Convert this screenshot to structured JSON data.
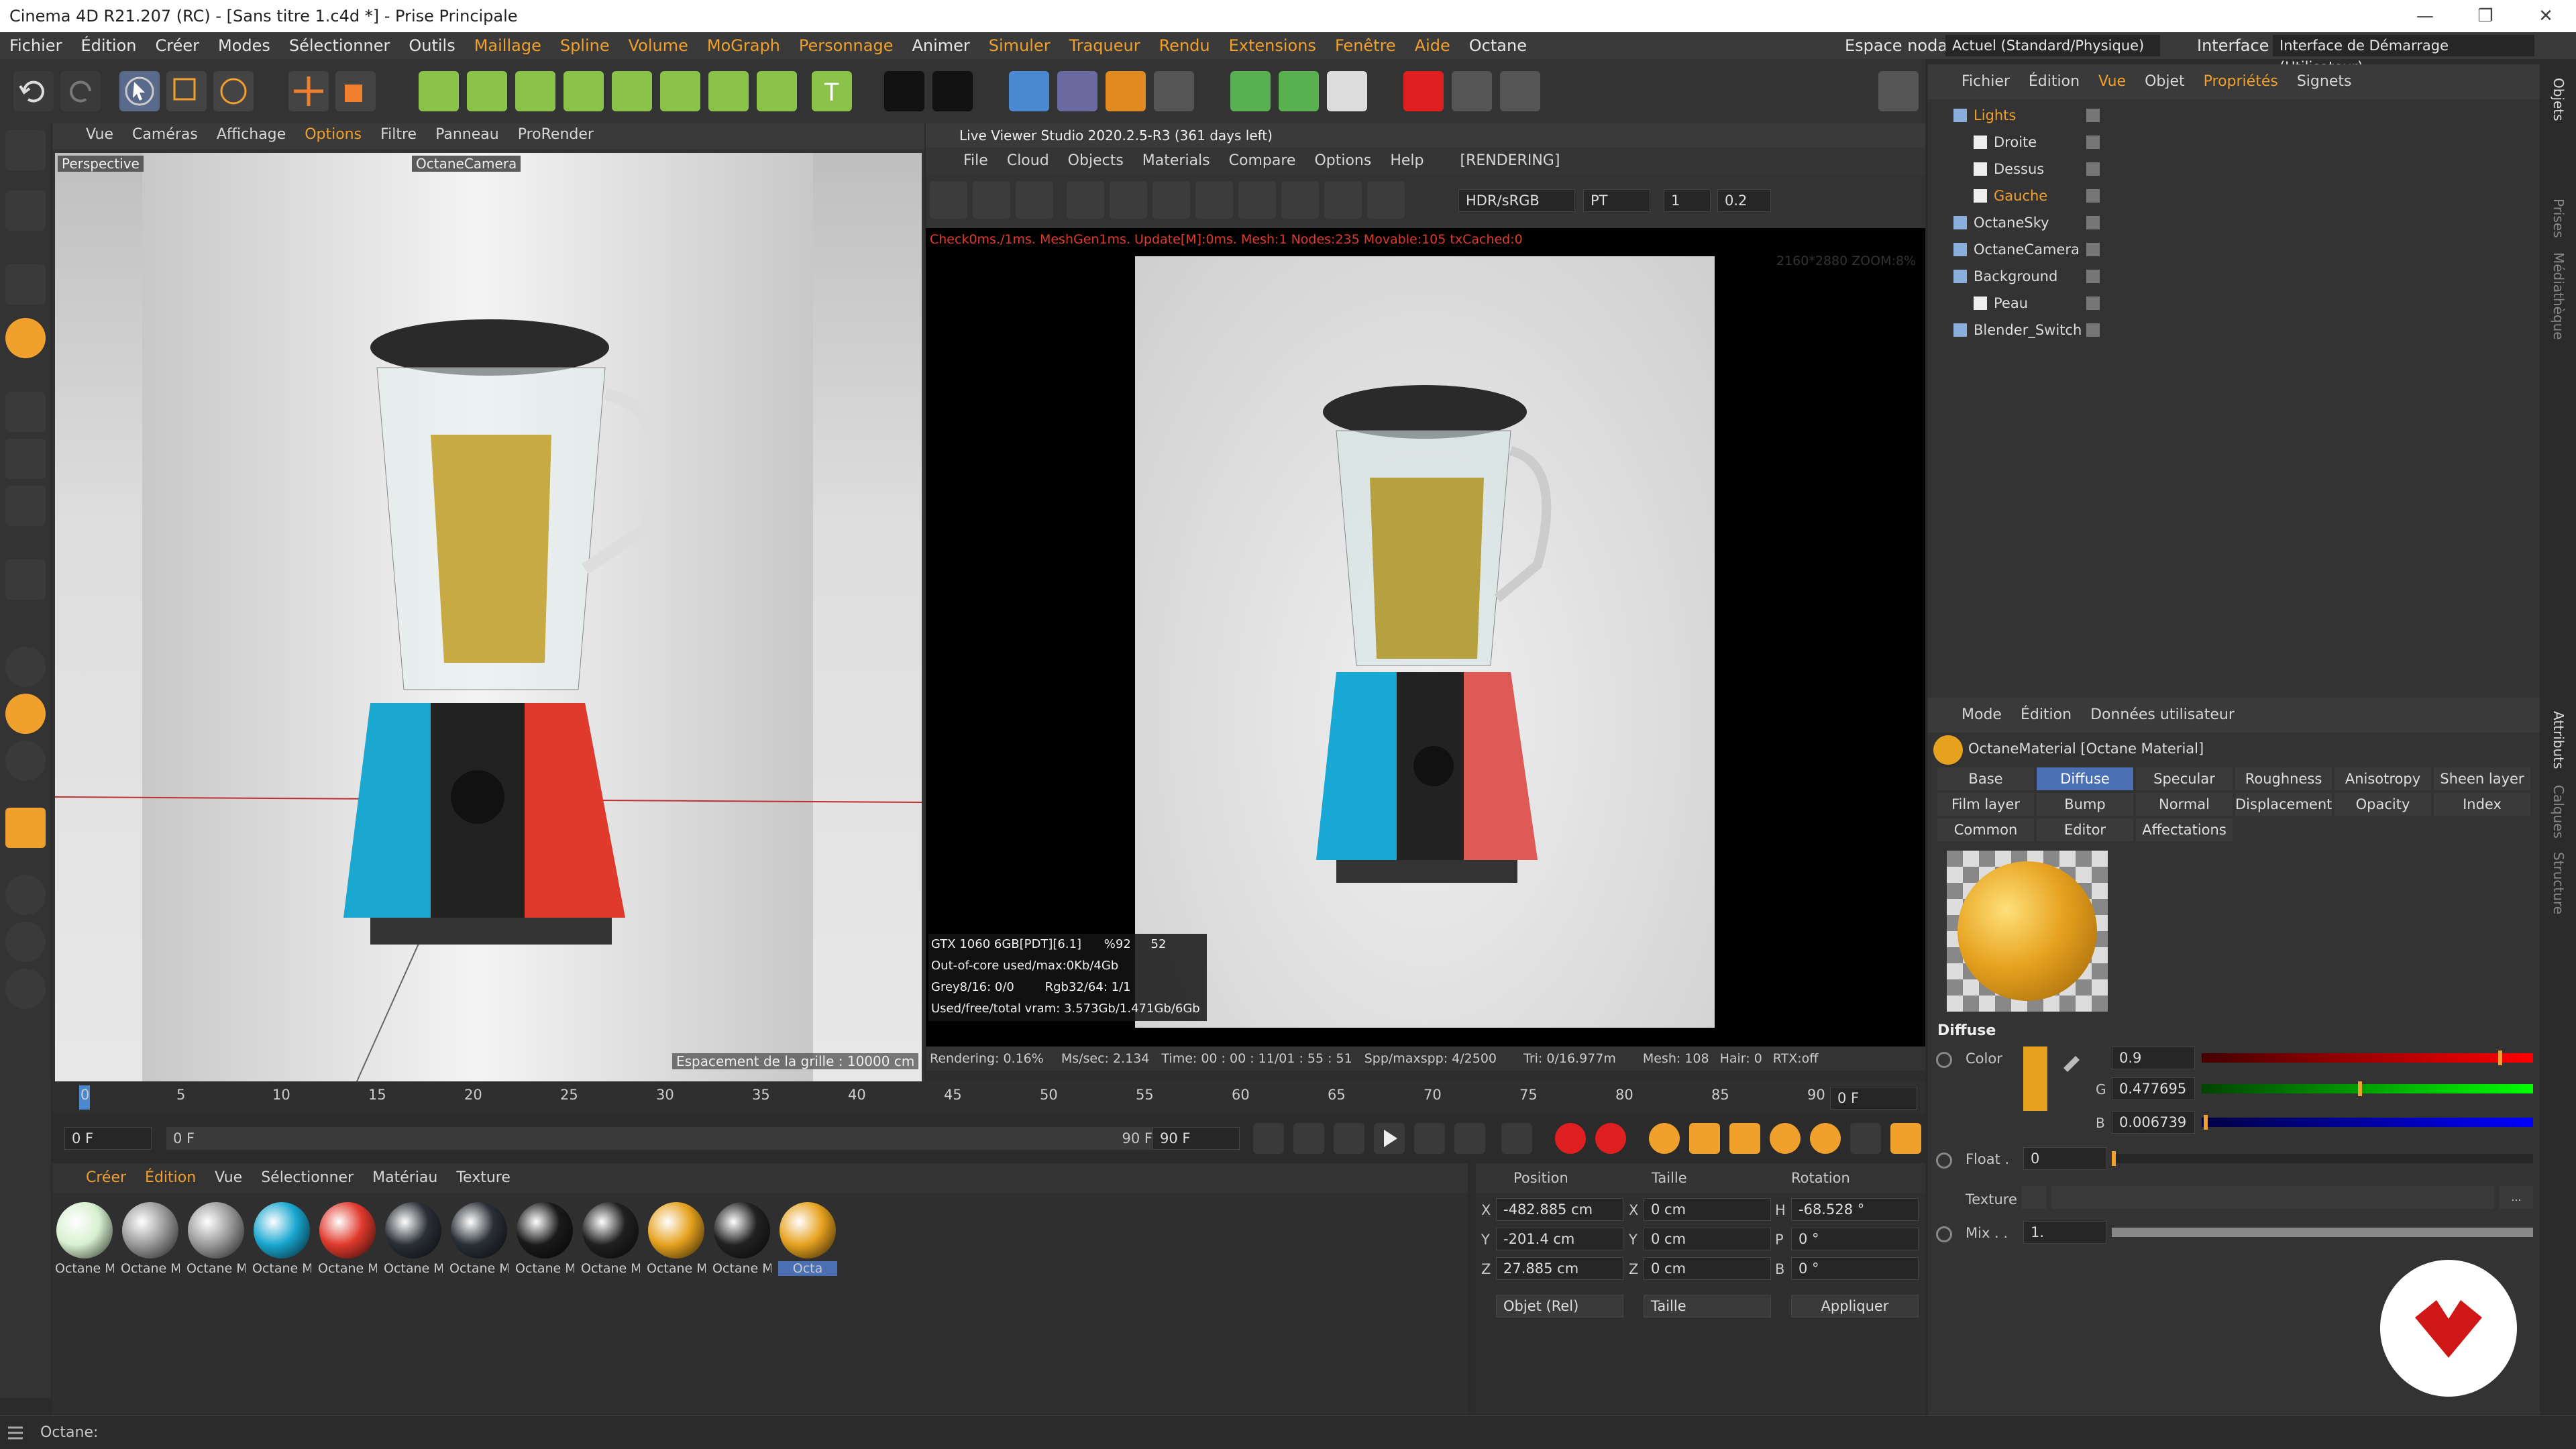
{
  "titlebar": {
    "title": "Cinema 4D R21.207 (RC) - [Sans titre 1.c4d *] - Prise Principale",
    "minimize": "—",
    "maximize": "❐",
    "close": "✕"
  },
  "menubar": {
    "items": [
      "Fichier",
      "Édition",
      "Créer",
      "Modes",
      "Sélectionner",
      "Outils",
      "Maillage",
      "Spline",
      "Volume",
      "MoGraph",
      "Personnage",
      "Animer",
      "Simuler",
      "Traqueur",
      "Rendu",
      "Extensions",
      "Fenêtre",
      "Aide",
      "Octane"
    ],
    "espace_nodal_label": "Espace nodal :",
    "espace_nodal_value": "Actuel (Standard/Physique)",
    "interface_label": "Interface :",
    "interface_value": "Interface de Démarrage (Utilisateur)"
  },
  "viewport": {
    "menu": [
      "Vue",
      "Caméras",
      "Affichage",
      "Options",
      "Filtre",
      "Panneau",
      "ProRender"
    ],
    "label": "Perspective",
    "camera": "OctaneCamera",
    "grid": "Espacement de la grille : 10000 cm"
  },
  "liveviewer": {
    "title": "Live Viewer Studio 2020.2.5-R3 (361 days left)",
    "menu": [
      "File",
      "Cloud",
      "Objects",
      "Materials",
      "Compare",
      "Options",
      "Help"
    ],
    "status": "[RENDERING]",
    "hdr": "HDR/sRGB",
    "mode": "PT",
    "val1": "1",
    "val2": "0.2",
    "check": "Check0ms./1ms. MeshGen1ms. Update[M]:0ms. Mesh:1 Nodes:235 Movable:105 txCached:0",
    "zoom": "2160*2880 ZOOM:8%",
    "gpu": "GTX 1060 6GB[PDT][6.1]",
    "gpu_pct": "%92",
    "gpu_temp": "52",
    "outofcore": "Out-of-core used/max:0Kb/4Gb",
    "grey": "Grey8/16: 0/0",
    "rgb": "Rgb32/64: 1/1",
    "vram": "Used/free/total vram: 3.573Gb/1.471Gb/6Gb",
    "rendering": "Rendering: 0.16%",
    "mssec": "Ms/sec: 2.134",
    "time": "Time: 00 : 00 : 11/01 : 55 : 51",
    "spp": "Spp/maxspp: 4/2500",
    "tri": "Tri: 0/16.977m",
    "mesh": "Mesh: 108",
    "hair": "Hair: 0",
    "rtx": "RTX:off"
  },
  "objects": {
    "menu": [
      "Fichier",
      "Édition",
      "Vue",
      "Objet",
      "Propriétés",
      "Signets"
    ],
    "rows": [
      {
        "name": "Lights",
        "indent": 0,
        "color": "#f0a02d"
      },
      {
        "name": "Droite",
        "indent": 1,
        "color": "#dddddd"
      },
      {
        "name": "Dessus",
        "indent": 1,
        "color": "#dddddd"
      },
      {
        "name": "Gauche",
        "indent": 1,
        "color": "#f0a02d"
      },
      {
        "name": "OctaneSky",
        "indent": 0,
        "color": "#dddddd"
      },
      {
        "name": "OctaneCamera",
        "indent": 0,
        "color": "#dddddd"
      },
      {
        "name": "Background",
        "indent": 0,
        "color": "#dddddd"
      },
      {
        "name": "Peau",
        "indent": 1,
        "color": "#dddddd"
      },
      {
        "name": "Blender_Switch",
        "indent": 0,
        "color": "#dddddd"
      }
    ],
    "side_tabs": [
      "Objets",
      "Prises",
      "Médiathèque"
    ]
  },
  "attributes": {
    "menu": [
      "Mode",
      "Édition",
      "Données utilisateur"
    ],
    "material": "OctaneMaterial [Octane Material]",
    "tabs_row1": [
      "Base",
      "Diffuse",
      "Specular",
      "Roughness",
      "Anisotropy",
      "Sheen layer"
    ],
    "tabs_row2": [
      "Film layer",
      "Bump",
      "Normal",
      "Displacement",
      "Opacity",
      "Index"
    ],
    "tabs_row3": [
      "Common",
      "Editor",
      "Affectations"
    ],
    "section": "Diffuse",
    "color_label": "Color",
    "r_label": "R",
    "r_value": "0.9",
    "r_level": 0.9,
    "g_label": "G",
    "g_value": "0.477695",
    "g_level": 0.477695,
    "b_label": "B",
    "b_value": "0.006739",
    "b_level": 0.006739,
    "float_label": "Float .",
    "float_value": "0",
    "texture_label": "Texture",
    "mix_label": "Mix . .",
    "mix_value": "1.",
    "side_tabs": [
      "Attributs",
      "Calques",
      "Structure"
    ],
    "color_swatch": "#e6a21f"
  },
  "timeline": {
    "ticks": [
      "0",
      "5",
      "10",
      "15",
      "20",
      "25",
      "30",
      "35",
      "40",
      "45",
      "50",
      "55",
      "60",
      "65",
      "70",
      "75",
      "80",
      "85",
      "90"
    ],
    "frame_end": "0 F",
    "start": "0 F",
    "start2": "0 F",
    "end": "90 F",
    "end2": "90 F"
  },
  "materials": {
    "menu": [
      "Créer",
      "Édition",
      "Vue",
      "Sélectionner",
      "Matériau",
      "Texture"
    ],
    "items": [
      {
        "label": "Octane M",
        "color": "#d8f0d0"
      },
      {
        "label": "Octane M",
        "color": "#9a9a9a"
      },
      {
        "label": "Octane M",
        "color": "#9a9a9a"
      },
      {
        "label": "Octane M",
        "color": "#1aa7d0"
      },
      {
        "label": "Octane M",
        "color": "#e03a2c"
      },
      {
        "label": "Octane M",
        "color": "#2a2f36"
      },
      {
        "label": "Octane M",
        "color": "#2a2f36"
      },
      {
        "label": "Octane M",
        "color": "#1a1a1a"
      },
      {
        "label": "Octane M",
        "color": "#202020"
      },
      {
        "label": "Octane M",
        "color": "#e6a21f"
      },
      {
        "label": "Octane M",
        "color": "#222222"
      },
      {
        "label": "Octa",
        "color": "#e6a21f"
      }
    ]
  },
  "coords": {
    "position_label": "Position",
    "taille_label": "Taille",
    "rotation_label": "Rotation",
    "x_label": "X",
    "y_label": "Y",
    "z_label": "Z",
    "h_label": "H",
    "p_label": "P",
    "b_label": "B",
    "px": "-482.885 cm",
    "py": "-201.4 cm",
    "pz": "27.885 cm",
    "sx": "0 cm",
    "sy": "0 cm",
    "sz": "0 cm",
    "rh": "-68.528 °",
    "rp": "0 °",
    "rb": "0 °",
    "mode": "Objet (Rel)",
    "size_mode": "Taille",
    "apply": "Appliquer"
  },
  "statusbar": {
    "text": "Octane:"
  }
}
